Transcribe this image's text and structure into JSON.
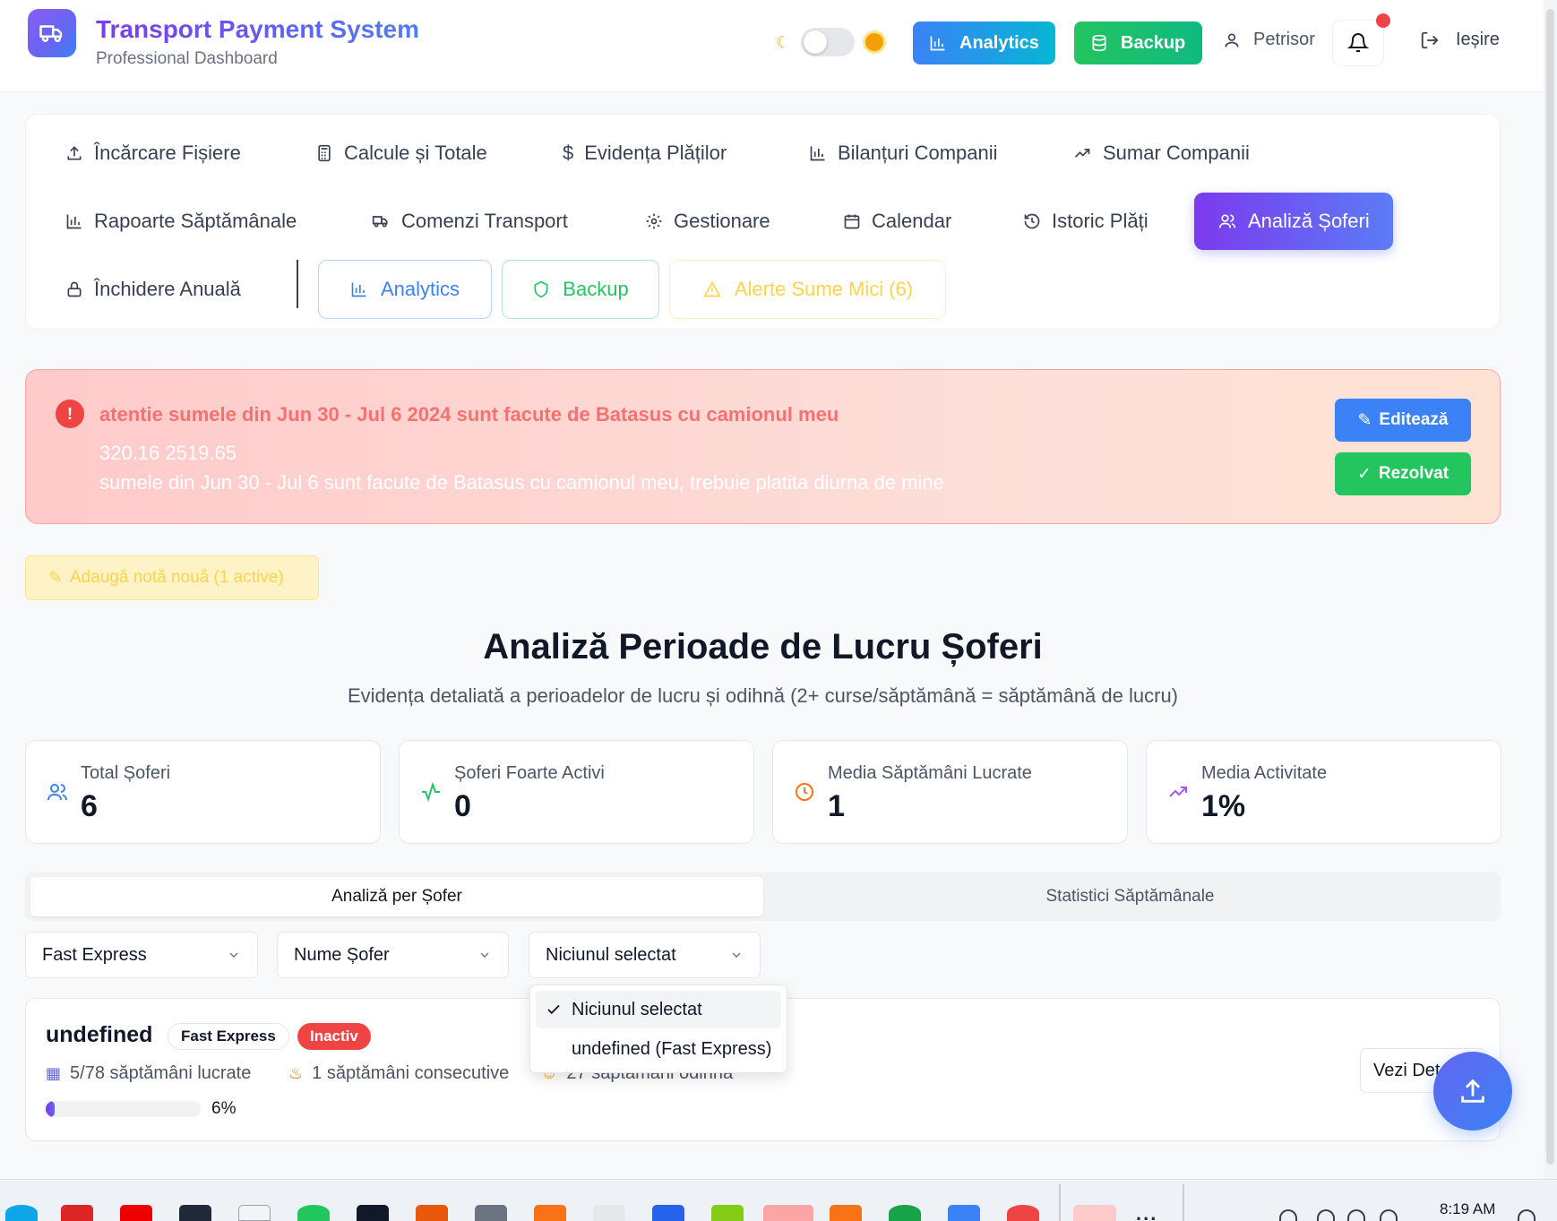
{
  "header": {
    "title": "Transport Payment System",
    "subtitle": "Professional Dashboard",
    "analytics_label": "Analytics",
    "backup_label": "Backup",
    "user_name": "Petrisor",
    "logout_label": "Ieșire"
  },
  "nav": {
    "items": [
      {
        "label": "Încărcare Fișiere",
        "icon": "upload-icon"
      },
      {
        "label": "Calcule și Totale",
        "icon": "calculator-icon"
      },
      {
        "label": "Evidența Plăților",
        "icon": "dollar-icon"
      },
      {
        "label": "Bilanțuri Companii",
        "icon": "bar-chart-icon"
      },
      {
        "label": "Sumar Companii",
        "icon": "trending-up-icon"
      },
      {
        "label": "Rapoarte Săptămânale",
        "icon": "bar-chart-icon"
      },
      {
        "label": "Comenzi Transport",
        "icon": "truck-icon"
      },
      {
        "label": "Gestionare",
        "icon": "gear-icon"
      },
      {
        "label": "Calendar",
        "icon": "calendar-icon"
      },
      {
        "label": "Istoric Plăți",
        "icon": "history-icon"
      },
      {
        "label": "Analiză Șoferi",
        "icon": "users-icon"
      },
      {
        "label": "Închidere Anuală",
        "icon": "lock-icon"
      }
    ],
    "analytics_label": "Analytics",
    "backup_label": "Backup",
    "alert_label": "Alerte Sume Mici (6)"
  },
  "note": {
    "title": "atentie sumele din Jun 30 - Jul 6 2024 sunt facute de Batasus cu camionul meu",
    "line1": "320.16 2519.65",
    "line2": "sumele din Jun 30 - Jul 6 sunt facute de Batasus cu camionul meu, trebuie platita diurna de mine",
    "edit_label": "Editează",
    "resolve_label": "Rezolvat"
  },
  "add_note_label": "Adaugă notă nouă (1 active)",
  "page": {
    "title": "Analiză Perioade de Lucru Șoferi",
    "subtitle": "Evidența detaliată a perioadelor de lucru și odihnă (2+ curse/săptămână = săptămână de lucru)"
  },
  "stats": [
    {
      "label": "Total Șoferi",
      "value": "6",
      "icon": "users-icon",
      "color": "#3b82f6"
    },
    {
      "label": "Șoferi Foarte Activi",
      "value": "0",
      "icon": "activity-icon",
      "color": "#22c55e"
    },
    {
      "label": "Media Săptămâni Lucrate",
      "value": "1",
      "icon": "clock-icon",
      "color": "#f97316"
    },
    {
      "label": "Media Activitate",
      "value": "1%",
      "icon": "trending-up-icon",
      "color": "#a855f7"
    }
  ],
  "tabs": [
    "Analiză per Șofer",
    "Statistici Săptămânale"
  ],
  "filters": {
    "company": "Fast Express",
    "driver_name": "Nume Șofer",
    "selection": "Niciunul selectat"
  },
  "dropdown": {
    "options": [
      "Niciunul selectat",
      "undefined (Fast Express)"
    ]
  },
  "driver": {
    "name": "undefined",
    "company": "Fast Express",
    "status": "Inactiv",
    "weeks_worked": "5/78 săptămâni lucrate",
    "consecutive": "1 săptămâni consecutive",
    "rest": "27 săptămâni odihnă",
    "progress_pct": "6%",
    "progress_value": 6,
    "details_label": "Vezi Detalii"
  },
  "taskbar": {
    "time": "8:19 AM",
    "more": "..."
  }
}
